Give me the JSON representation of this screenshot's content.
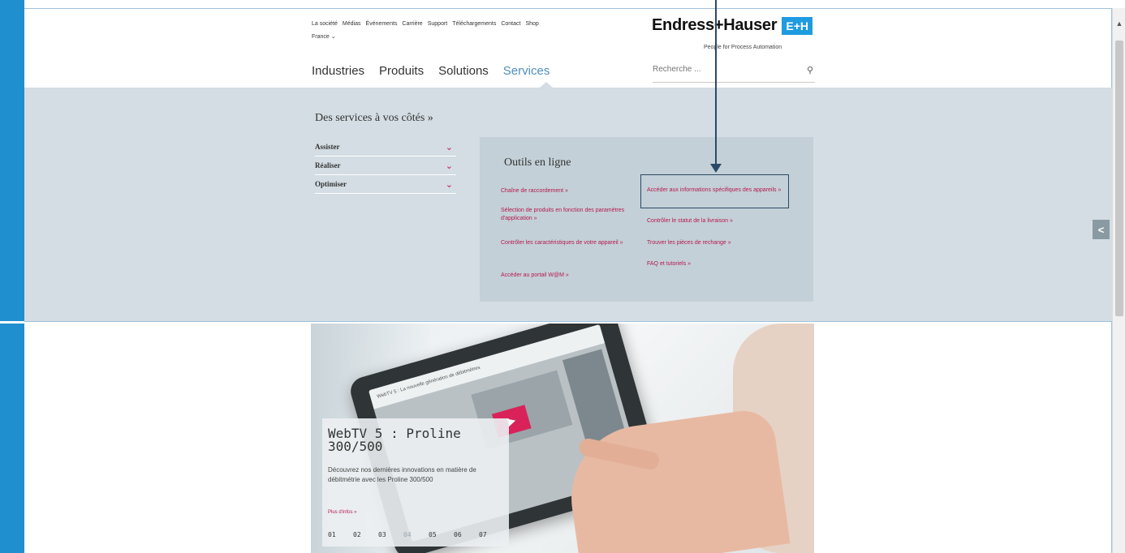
{
  "header": {
    "top_links": [
      "La société",
      "Médias",
      "Événements",
      "Carrière",
      "Support",
      "Téléchargements",
      "Contact",
      "Shop"
    ],
    "country": "France ⌄",
    "logo_text": "Endress+Hauser",
    "logo_badge": "E+H",
    "tagline": "People for Process Automation",
    "nav": [
      "Industries",
      "Produits",
      "Solutions",
      "Services"
    ],
    "active_nav_index": 3,
    "search_placeholder": "Recherche ...",
    "search_icon": "magnifier"
  },
  "mega_menu": {
    "title": "Des services à vos côtés »",
    "accordion": [
      {
        "label": "Assister"
      },
      {
        "label": "Réaliser"
      },
      {
        "label": "Optimiser"
      }
    ],
    "tools": {
      "title": "Outils en ligne",
      "left_links": [
        "Chaîne de raccordement »",
        "Sélection de produits en fonction des paramètres d'application »",
        "Contrôler les caractéristiques de votre appareil »",
        "Accéder au portail W@M »"
      ],
      "right_links": [
        "Accéder aux informations spécifiques des appareils »",
        "Contrôler le statut de la livraison »",
        "Trouver les pièces de rechange »",
        "FAQ et tutoriels »"
      ]
    }
  },
  "hero": {
    "screen_caption": "WebTV 5 : La nouvelle génération de débitmètres",
    "title": "WebTV 5 : Proline 300/500",
    "description": "Découvrez nos dernières innovations en matière de débitmétrie avec les Proline 300/500",
    "more": "Plus d'infos »",
    "pager": [
      "01",
      "02",
      "03",
      "04",
      "05",
      "06",
      "07"
    ]
  },
  "colors": {
    "accent_blue": "#1f8fd0",
    "link_magenta": "#b5194f",
    "panel_grey": "#d3dde3"
  }
}
